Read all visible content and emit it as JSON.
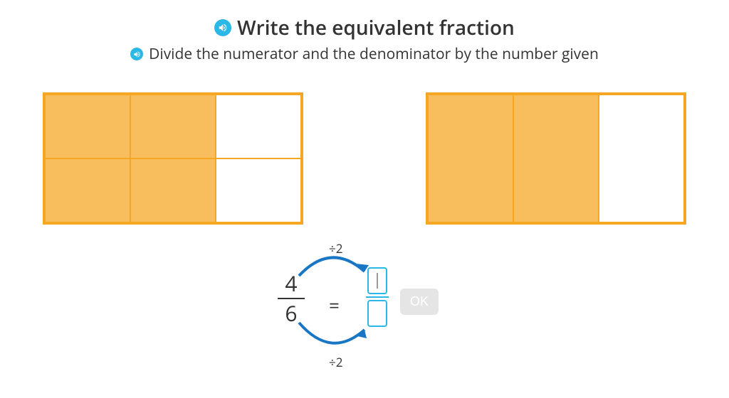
{
  "header": {
    "title": "Write the equivalent fraction",
    "subtitle": "Divide the numerator and the denominator by the number given"
  },
  "grids": {
    "left": {
      "rows": 2,
      "cols": 3,
      "filled": [
        true,
        true,
        false,
        true,
        true,
        false
      ]
    },
    "right": {
      "rows": 1,
      "cols": 3,
      "filled": [
        true,
        true,
        false
      ]
    }
  },
  "equation": {
    "numerator": "4",
    "denominator": "6",
    "operation_top": "÷2",
    "operation_bottom": "÷2",
    "equals": "=",
    "answer_numerator": "",
    "answer_denominator": ""
  },
  "buttons": {
    "ok": "OK"
  },
  "colors": {
    "accent_orange": "#F5A623",
    "fill_orange": "#F8BE5E",
    "accent_blue": "#2BB8E6",
    "arrow_blue": "#1976C5"
  }
}
